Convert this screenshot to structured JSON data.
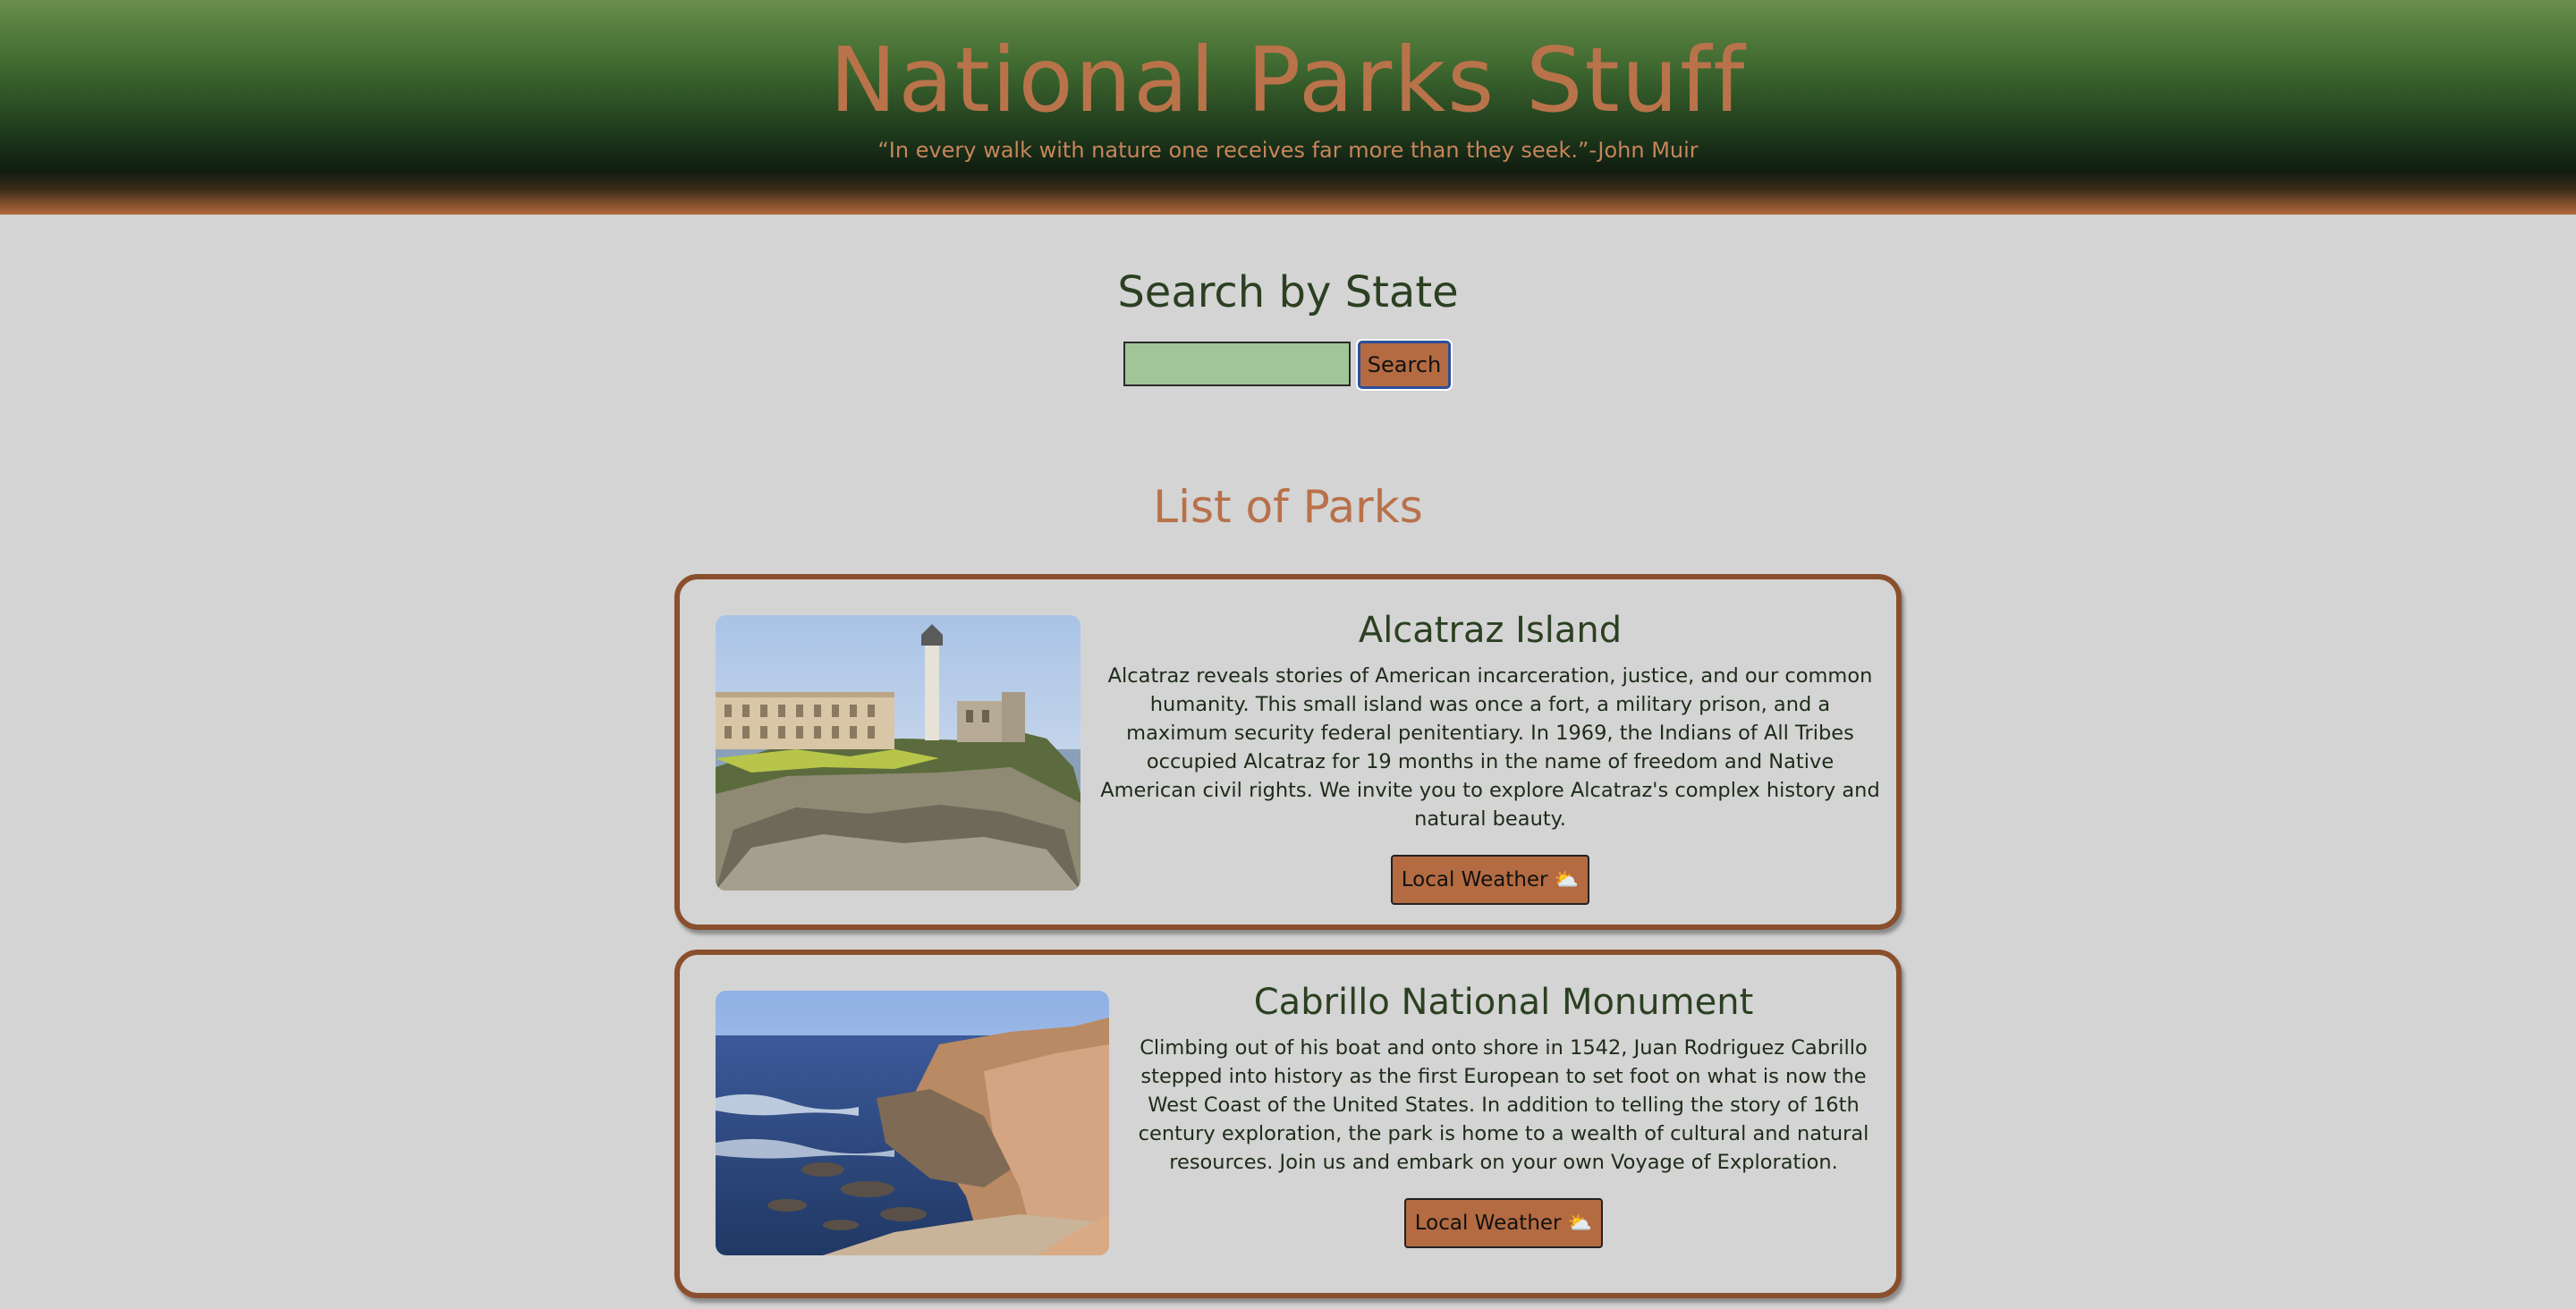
{
  "header": {
    "title": "National Parks Stuff",
    "quote": "“In every walk with nature one receives far more than they seek.”-John Muir"
  },
  "search": {
    "title": "Search by State",
    "input_value": "",
    "button_label": "Search"
  },
  "list": {
    "title": "List of Parks",
    "parks": [
      {
        "name": "Alcatraz Island",
        "description": "Alcatraz reveals stories of American incarceration, justice, and our common humanity. This small island was once a fort, a military prison, and a maximum security federal penitentiary. In 1969, the Indians of All Tribes occupied Alcatraz for 19 months in the name of freedom and Native American civil rights. We invite you to explore Alcatraz's complex history and natural beauty.",
        "weather_label": "Local Weather",
        "weather_icon": "⛅"
      },
      {
        "name": "Cabrillo National Monument",
        "description": "Climbing out of his boat and onto shore in 1542, Juan Rodriguez Cabrillo stepped into history as the first European to set foot on what is now the West Coast of the United States. In addition to telling the story of 16th century exploration, the park is home to a wealth of cultural and natural resources. Join us and embark on your own Voyage of Exploration.",
        "weather_label": "Local Weather",
        "weather_icon": "⛅"
      }
    ]
  },
  "colors": {
    "background": "#d4d4d4",
    "accent": "#b46b42",
    "dark_green": "#2b4022",
    "card_border": "#8a4f2d",
    "input_fill": "#a1c499"
  }
}
